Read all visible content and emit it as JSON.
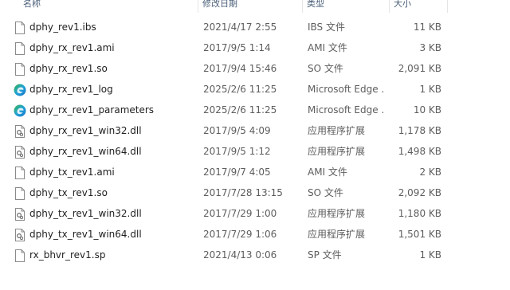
{
  "header": {
    "name": "名称",
    "date": "修改日期",
    "type": "类型",
    "size": "大小"
  },
  "colors": {
    "header_text": "#4c607a",
    "row_text": "#1f1f1f",
    "meta_text": "#5d5d5d",
    "edge_blue": "#1a73c8",
    "edge_green": "#3bb34a"
  },
  "files": [
    {
      "name": "dphy_rev1.ibs",
      "date": "2021/4/17 2:55",
      "type": "IBS 文件",
      "size": "11 KB",
      "icon": "generic-file-icon"
    },
    {
      "name": "dphy_rx_rev1.ami",
      "date": "2017/9/5 1:14",
      "type": "AMI 文件",
      "size": "3 KB",
      "icon": "generic-file-icon"
    },
    {
      "name": "dphy_rx_rev1.so",
      "date": "2017/9/4 15:46",
      "type": "SO 文件",
      "size": "2,091 KB",
      "icon": "generic-file-icon"
    },
    {
      "name": "dphy_rx_rev1_log",
      "date": "2025/2/6 11:25",
      "type": "Microsoft Edge ...",
      "size": "1 KB",
      "icon": "edge-icon"
    },
    {
      "name": "dphy_rx_rev1_parameters",
      "date": "2025/2/6 11:25",
      "type": "Microsoft Edge ...",
      "size": "10 KB",
      "icon": "edge-icon"
    },
    {
      "name": "dphy_rx_rev1_win32.dll",
      "date": "2017/9/5 4:09",
      "type": "应用程序扩展",
      "size": "1,178 KB",
      "icon": "dll-icon"
    },
    {
      "name": "dphy_rx_rev1_win64.dll",
      "date": "2017/9/5 1:12",
      "type": "应用程序扩展",
      "size": "1,498 KB",
      "icon": "dll-icon"
    },
    {
      "name": "dphy_tx_rev1.ami",
      "date": "2017/9/7 4:05",
      "type": "AMI 文件",
      "size": "2 KB",
      "icon": "generic-file-icon"
    },
    {
      "name": "dphy_tx_rev1.so",
      "date": "2017/7/28 13:15",
      "type": "SO 文件",
      "size": "2,092 KB",
      "icon": "generic-file-icon"
    },
    {
      "name": "dphy_tx_rev1_win32.dll",
      "date": "2017/7/29 1:00",
      "type": "应用程序扩展",
      "size": "1,180 KB",
      "icon": "dll-icon"
    },
    {
      "name": "dphy_tx_rev1_win64.dll",
      "date": "2017/7/29 1:06",
      "type": "应用程序扩展",
      "size": "1,501 KB",
      "icon": "dll-icon"
    },
    {
      "name": "rx_bhvr_rev1.sp",
      "date": "2021/4/13 0:06",
      "type": "SP 文件",
      "size": "1 KB",
      "icon": "generic-file-icon"
    }
  ]
}
